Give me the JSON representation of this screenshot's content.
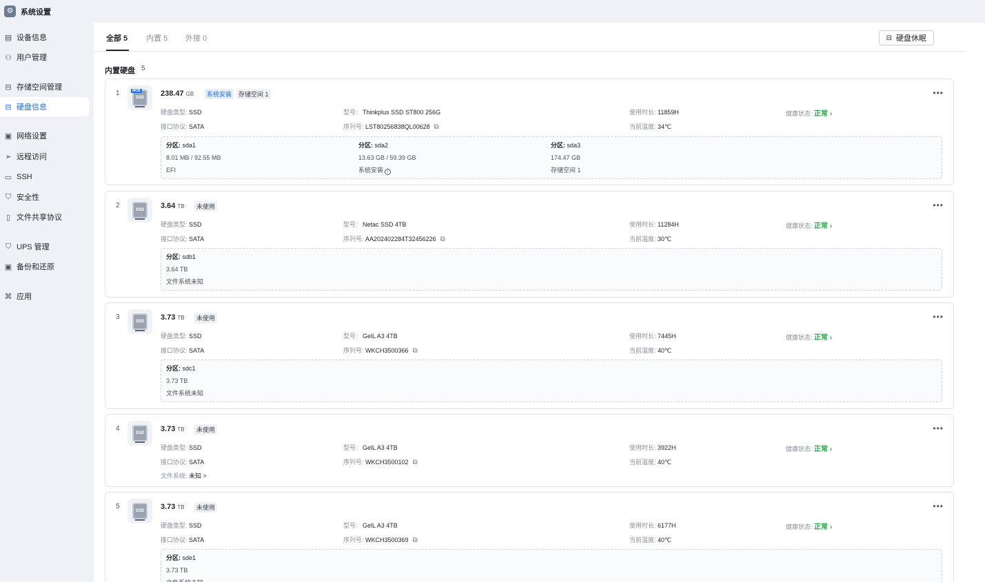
{
  "app": {
    "title": "系统设置",
    "logo_icon": "gear-icon"
  },
  "sidebar": {
    "items": [
      {
        "label": "设备信息",
        "icon": "device-info-icon"
      },
      {
        "label": "用户管理",
        "icon": "user-icon"
      },
      {
        "label": "存储空间管理",
        "icon": "storage-icon"
      },
      {
        "label": "硬盘信息",
        "icon": "disk-icon",
        "active": true
      },
      {
        "label": "网络设置",
        "icon": "network-icon"
      },
      {
        "label": "远程访问",
        "icon": "send-icon"
      },
      {
        "label": "SSH",
        "icon": "terminal-icon"
      },
      {
        "label": "安全性",
        "icon": "shield-icon"
      },
      {
        "label": "文件共享协议",
        "icon": "document-icon"
      },
      {
        "label": "UPS 管理",
        "icon": "shield-outline-icon"
      },
      {
        "label": "备份和还原",
        "icon": "save-icon"
      },
      {
        "label": "应用",
        "icon": "apps-icon"
      }
    ]
  },
  "tabs": [
    {
      "label": "全部 5",
      "active": true
    },
    {
      "label": "内置 5"
    },
    {
      "label": "外接 0"
    }
  ],
  "sleep_button": {
    "label": "硬盘休眠"
  },
  "section": {
    "title": "内置硬盘",
    "count": "5"
  },
  "labels": {
    "type": "硬盘类型:",
    "interface": "接口协议:",
    "model": "型号:",
    "serial": "序列号:",
    "hours": "使用时长:",
    "temp": "当前温度:",
    "health": "健康状态:",
    "partition": "分区:",
    "filesystem": "文件系统:"
  },
  "colors": {
    "accent": "#1c6bf0",
    "healthy": "#2ca84a"
  },
  "disks": [
    {
      "index": "1",
      "size": "238.47",
      "unit": "GB",
      "icon_label": "SSD",
      "nas_tag": "MOB",
      "tags": [
        {
          "text": "系统安装",
          "style": "blue"
        },
        {
          "text": "存储空间 1",
          "style": "gray"
        }
      ],
      "type": "SSD",
      "interface": "SATA",
      "model": "Thinkplus SSD ST800 256G",
      "serial": "LST80256838QL00628",
      "hours": "11859H",
      "temp": "34℃",
      "health": "正常 ›",
      "partitions": [
        {
          "name": "sda1",
          "usage": "8.01 MB / 92.55 MB",
          "fs": "EFI"
        },
        {
          "name": "sda2",
          "usage": "13.63 GB / 59.39 GB",
          "fs": "系统安装"
        },
        {
          "name": "sda3",
          "usage": "174.47 GB",
          "fs": "存储空间 1"
        }
      ]
    },
    {
      "index": "2",
      "size": "3.64",
      "unit": "TB",
      "icon_label": "SSD",
      "tags": [
        {
          "text": "未使用",
          "style": "gray"
        }
      ],
      "type": "SSD",
      "interface": "SATA",
      "model": "Netac SSD 4TB",
      "serial": "AA202402284T32456226",
      "hours": "11284H",
      "temp": "30℃",
      "health": "正常 ›",
      "partitions": [
        {
          "name": "sdb1",
          "usage": "3.64 TB",
          "fs": "文件系统未知"
        }
      ]
    },
    {
      "index": "3",
      "size": "3.73",
      "unit": "TB",
      "icon_label": "SSD",
      "tags": [
        {
          "text": "未使用",
          "style": "gray"
        }
      ],
      "type": "SSD",
      "interface": "SATA",
      "model": "GelL A3 4TB",
      "serial": "WKCH3500366",
      "hours": "7445H",
      "temp": "40℃",
      "health": "正常 ›",
      "partitions": [
        {
          "name": "sdc1",
          "usage": "3.73 TB",
          "fs": "文件系统未知"
        }
      ]
    },
    {
      "index": "4",
      "size": "3.73",
      "unit": "TB",
      "icon_label": "SSD",
      "tags": [
        {
          "text": "未使用",
          "style": "gray"
        }
      ],
      "type": "SSD",
      "interface": "SATA",
      "model": "GelL A3 4TB",
      "serial": "WKCH3500102",
      "hours": "3922H",
      "temp": "40℃",
      "health": "正常 ›",
      "filesystem": "未知 >"
    },
    {
      "index": "5",
      "size": "3.73",
      "unit": "TB",
      "icon_label": "SSD",
      "tags": [
        {
          "text": "未使用",
          "style": "gray"
        }
      ],
      "type": "SSD",
      "interface": "SATA",
      "model": "GelL A3 4TB",
      "serial": "WKCH3500369",
      "hours": "6177H",
      "temp": "40℃",
      "health": "正常 ›",
      "partitions": [
        {
          "name": "sde1",
          "usage": "3.73 TB",
          "fs": "文件系统未知"
        }
      ]
    }
  ]
}
